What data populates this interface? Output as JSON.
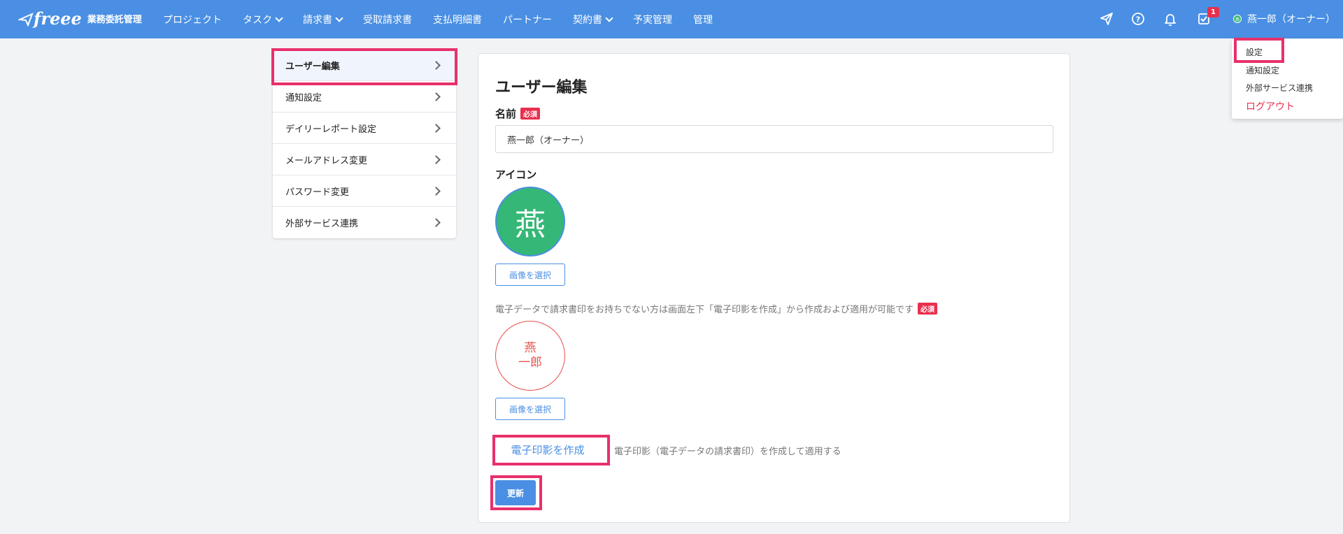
{
  "header": {
    "logo_text": "freee",
    "app_title": "業務委託管理",
    "nav": [
      {
        "label": "プロジェクト",
        "has_dropdown": false
      },
      {
        "label": "タスク",
        "has_dropdown": true
      },
      {
        "label": "請求書",
        "has_dropdown": true
      },
      {
        "label": "受取請求書",
        "has_dropdown": false
      },
      {
        "label": "支払明細書",
        "has_dropdown": false
      },
      {
        "label": "パートナー",
        "has_dropdown": false
      },
      {
        "label": "契約書",
        "has_dropdown": true
      },
      {
        "label": "予実管理",
        "has_dropdown": false
      },
      {
        "label": "管理",
        "has_dropdown": false
      }
    ],
    "icons": [
      "send-icon",
      "help-icon",
      "bell-icon",
      "task-check-icon"
    ],
    "task_badge": "1",
    "user_name": "燕一郎（オーナー）",
    "user_avatar_char": "燕"
  },
  "user_dropdown": {
    "items": [
      "設定",
      "通知設定",
      "外部サービス連携"
    ],
    "logout": "ログアウト"
  },
  "sidebar": {
    "items": [
      {
        "label": "ユーザー編集",
        "active": true
      },
      {
        "label": "通知設定",
        "active": false
      },
      {
        "label": "デイリーレポート設定",
        "active": false
      },
      {
        "label": "メールアドレス変更",
        "active": false
      },
      {
        "label": "パスワード変更",
        "active": false
      },
      {
        "label": "外部サービス連携",
        "active": false
      }
    ]
  },
  "main": {
    "title": "ユーザー編集",
    "name_label": "名前",
    "required_badge": "必須",
    "name_value": "燕一郎（オーナー）",
    "icon_label": "アイコン",
    "avatar_char": "燕",
    "select_image_label": "画像を選択",
    "stamp_note": "電子データで請求書印をお持ちでない方は画面左下「電子印影を作成」から作成および適用が可能です",
    "stamp_line1": "燕",
    "stamp_line2": "一郎",
    "create_stamp_label": "電子印影を作成",
    "create_stamp_note": "電子印影（電子データの請求書印）を作成して適用する",
    "submit_label": "更新"
  },
  "colors": {
    "header_bg": "#4a8fe3",
    "accent": "#4a8fe3",
    "required": "#e8304d",
    "highlight": "#e8306a",
    "avatar": "#35b777",
    "stamp": "#e8504a"
  }
}
